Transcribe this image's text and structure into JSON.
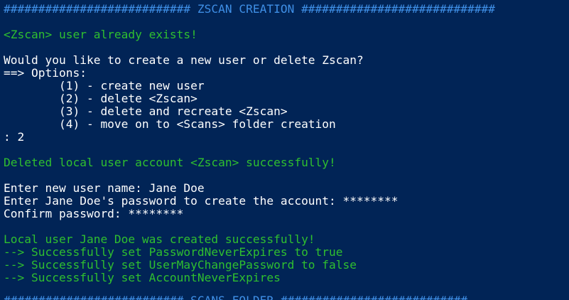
{
  "colors": {
    "background": "#012456",
    "text": "#ffffff",
    "success": "#2fbf2f",
    "header": "#3f8fe6"
  },
  "lines": [
    {
      "text": "########################### ZSCAN CREATION ############################",
      "color": "header"
    },
    {
      "text": "<Zscan> user already exists!",
      "color": "success"
    },
    {
      "text": "Would you like to create a new user or delete Zscan?",
      "color": "text"
    },
    {
      "text": "==> Options:",
      "color": "text"
    },
    {
      "text": "        (1) - create new user",
      "color": "text"
    },
    {
      "text": "        (2) - delete <Zscan>",
      "color": "text"
    },
    {
      "text": "        (3) - delete and recreate <Zscan>",
      "color": "text"
    },
    {
      "text": "        (4) - move on to <Scans> folder creation",
      "color": "text"
    },
    {
      "text": ": 2",
      "color": "text"
    },
    {
      "text": "Deleted local user account <Zscan> successfully!",
      "color": "success"
    },
    {
      "text": "Enter new user name: Jane Doe",
      "color": "text"
    },
    {
      "text": "Enter Jane Doe's password to create the account: ********",
      "color": "text"
    },
    {
      "text": "Confirm password: ********",
      "color": "text"
    },
    {
      "text": "Local user Jane Doe was created successfully!",
      "color": "success"
    },
    {
      "text": "--> Successfully set PasswordNeverExpires to true",
      "color": "success"
    },
    {
      "text": "--> Successfully set UserMayChangePassword to false",
      "color": "success"
    },
    {
      "text": "--> Successfully set AccountNeverExpires",
      "color": "success"
    },
    {
      "text": "########################## SCANS FOLDER ###########################",
      "color": "header"
    }
  ]
}
